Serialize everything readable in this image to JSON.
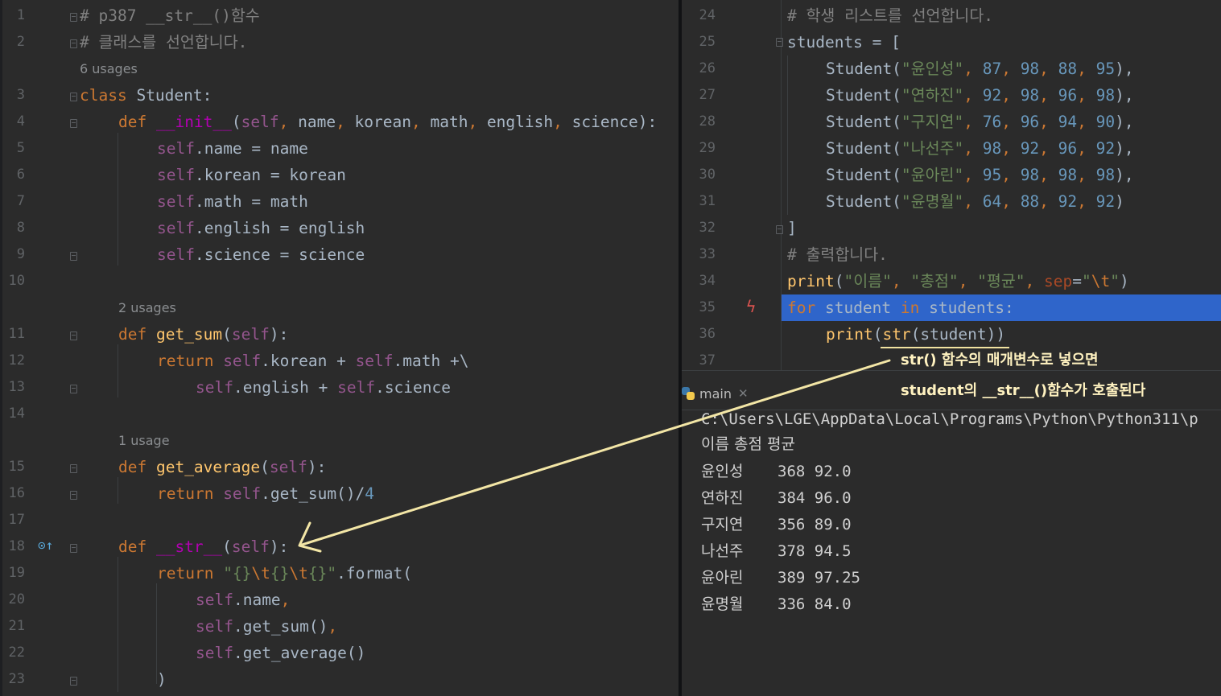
{
  "left_editor": {
    "lines": [
      {
        "n": "1",
        "t": [
          [
            "cmt",
            "# p387 __str__()함수"
          ]
        ]
      },
      {
        "n": "2",
        "t": [
          [
            "cmt",
            "# 클래스를 선언합니다."
          ]
        ]
      },
      {
        "n": "3",
        "t": [
          [
            "kw",
            "class "
          ],
          [
            "",
            "Student:"
          ]
        ]
      },
      {
        "n": "4",
        "t": [
          [
            "kw",
            "def "
          ],
          [
            "dunder",
            "__init__"
          ],
          [
            "",
            "("
          ],
          [
            "self",
            "self"
          ],
          [
            "kw",
            ", "
          ],
          [
            "",
            "name"
          ],
          [
            "kw",
            ", "
          ],
          [
            "",
            "korean"
          ],
          [
            "kw",
            ", "
          ],
          [
            "",
            "math"
          ],
          [
            "kw",
            ", "
          ],
          [
            "",
            "english"
          ],
          [
            "kw",
            ", "
          ],
          [
            "",
            "science):"
          ]
        ]
      },
      {
        "n": "5",
        "t": [
          [
            "self",
            "self"
          ],
          [
            "",
            ".name = name"
          ]
        ]
      },
      {
        "n": "6",
        "t": [
          [
            "self",
            "self"
          ],
          [
            "",
            ".korean = korean"
          ]
        ]
      },
      {
        "n": "7",
        "t": [
          [
            "self",
            "self"
          ],
          [
            "",
            ".math = math"
          ]
        ]
      },
      {
        "n": "8",
        "t": [
          [
            "self",
            "self"
          ],
          [
            "",
            ".english = english"
          ]
        ]
      },
      {
        "n": "9",
        "t": [
          [
            "self",
            "self"
          ],
          [
            "",
            ".science = science"
          ]
        ]
      },
      {
        "n": "10",
        "t": []
      },
      {
        "n": "11",
        "t": [
          [
            "kw",
            "def "
          ],
          [
            "fn",
            "get_sum"
          ],
          [
            "",
            "("
          ],
          [
            "self",
            "self"
          ],
          [
            "",
            "):"
          ]
        ]
      },
      {
        "n": "12",
        "t": [
          [
            "kw",
            "return "
          ],
          [
            "self",
            "self"
          ],
          [
            "",
            ".korean + "
          ],
          [
            "self",
            "self"
          ],
          [
            "",
            ".math +\\"
          ]
        ]
      },
      {
        "n": "13",
        "t": [
          [
            "self",
            "self"
          ],
          [
            "",
            ".english + "
          ],
          [
            "self",
            "self"
          ],
          [
            "",
            ".science"
          ]
        ]
      },
      {
        "n": "14",
        "t": []
      },
      {
        "n": "15",
        "t": [
          [
            "kw",
            "def "
          ],
          [
            "fn",
            "get_average"
          ],
          [
            "",
            "("
          ],
          [
            "self",
            "self"
          ],
          [
            "",
            "):"
          ]
        ]
      },
      {
        "n": "16",
        "t": [
          [
            "kw",
            "return "
          ],
          [
            "self",
            "self"
          ],
          [
            "",
            ".get_sum()/"
          ],
          [
            "num",
            "4"
          ]
        ]
      },
      {
        "n": "17",
        "t": []
      },
      {
        "n": "18",
        "t": [
          [
            "kw",
            "def "
          ],
          [
            "dunder",
            "__str__"
          ],
          [
            "",
            "("
          ],
          [
            "self",
            "self"
          ],
          [
            "",
            "):"
          ]
        ]
      },
      {
        "n": "19",
        "t": [
          [
            "kw",
            "return "
          ],
          [
            "str",
            "\"{}"
          ],
          [
            "esc",
            "\\t"
          ],
          [
            "str",
            "{}"
          ],
          [
            "esc",
            "\\t"
          ],
          [
            "str",
            "{}\""
          ],
          [
            "",
            ".format("
          ]
        ]
      },
      {
        "n": "20",
        "t": [
          [
            "self",
            "self"
          ],
          [
            "",
            ".name"
          ],
          [
            "kw",
            ","
          ]
        ]
      },
      {
        "n": "21",
        "t": [
          [
            "self",
            "self"
          ],
          [
            "",
            ".get_sum()"
          ],
          [
            "kw",
            ","
          ]
        ]
      },
      {
        "n": "22",
        "t": [
          [
            "self",
            "self"
          ],
          [
            "",
            ".get_average()"
          ]
        ]
      },
      {
        "n": "23",
        "t": [
          [
            "",
            ")"
          ]
        ]
      }
    ],
    "usage_hints": [
      "6 usages",
      "2 usages",
      "1 usage"
    ]
  },
  "right_editor": {
    "lines": [
      {
        "n": "24",
        "t": [
          [
            "cmt",
            "# 학생 리스트를 선언합니다."
          ]
        ]
      },
      {
        "n": "25",
        "t": [
          [
            "",
            "students = ["
          ]
        ]
      },
      {
        "n": "26",
        "t": [
          [
            "",
            "Student("
          ],
          [
            "str",
            "\"윤인성\""
          ],
          [
            "kw",
            ", "
          ],
          [
            "num",
            "87"
          ],
          [
            "kw",
            ", "
          ],
          [
            "num",
            "98"
          ],
          [
            "kw",
            ", "
          ],
          [
            "num",
            "88"
          ],
          [
            "kw",
            ", "
          ],
          [
            "num",
            "95"
          ],
          [
            "",
            "),"
          ]
        ]
      },
      {
        "n": "27",
        "t": [
          [
            "",
            "Student("
          ],
          [
            "str",
            "\"연하진\""
          ],
          [
            "kw",
            ", "
          ],
          [
            "num",
            "92"
          ],
          [
            "kw",
            ", "
          ],
          [
            "num",
            "98"
          ],
          [
            "kw",
            ", "
          ],
          [
            "num",
            "96"
          ],
          [
            "kw",
            ", "
          ],
          [
            "num",
            "98"
          ],
          [
            "",
            "),"
          ]
        ]
      },
      {
        "n": "28",
        "t": [
          [
            "",
            "Student("
          ],
          [
            "str",
            "\"구지연\""
          ],
          [
            "kw",
            ", "
          ],
          [
            "num",
            "76"
          ],
          [
            "kw",
            ", "
          ],
          [
            "num",
            "96"
          ],
          [
            "kw",
            ", "
          ],
          [
            "num",
            "94"
          ],
          [
            "kw",
            ", "
          ],
          [
            "num",
            "90"
          ],
          [
            "",
            "),"
          ]
        ]
      },
      {
        "n": "29",
        "t": [
          [
            "",
            "Student("
          ],
          [
            "str",
            "\"나선주\""
          ],
          [
            "kw",
            ", "
          ],
          [
            "num",
            "98"
          ],
          [
            "kw",
            ", "
          ],
          [
            "num",
            "92"
          ],
          [
            "kw",
            ", "
          ],
          [
            "num",
            "96"
          ],
          [
            "kw",
            ", "
          ],
          [
            "num",
            "92"
          ],
          [
            "",
            "),"
          ]
        ]
      },
      {
        "n": "30",
        "t": [
          [
            "",
            "Student("
          ],
          [
            "str",
            "\"윤아린\""
          ],
          [
            "kw",
            ", "
          ],
          [
            "num",
            "95"
          ],
          [
            "kw",
            ", "
          ],
          [
            "num",
            "98"
          ],
          [
            "kw",
            ", "
          ],
          [
            "num",
            "98"
          ],
          [
            "kw",
            ", "
          ],
          [
            "num",
            "98"
          ],
          [
            "",
            "),"
          ]
        ]
      },
      {
        "n": "31",
        "t": [
          [
            "",
            "Student("
          ],
          [
            "str",
            "\"윤명월\""
          ],
          [
            "kw",
            ", "
          ],
          [
            "num",
            "64"
          ],
          [
            "kw",
            ", "
          ],
          [
            "num",
            "88"
          ],
          [
            "kw",
            ", "
          ],
          [
            "num",
            "92"
          ],
          [
            "kw",
            ", "
          ],
          [
            "num",
            "92"
          ],
          [
            "",
            ")"
          ]
        ]
      },
      {
        "n": "32",
        "t": [
          [
            "",
            "]"
          ]
        ]
      },
      {
        "n": "33",
        "t": [
          [
            "cmt",
            "# 출력합니다."
          ]
        ]
      },
      {
        "n": "34",
        "t": [
          [
            "fn2",
            "print"
          ],
          [
            "",
            "("
          ],
          [
            "str",
            "\"이름\""
          ],
          [
            "kw",
            ", "
          ],
          [
            "str",
            "\"총점\""
          ],
          [
            "kw",
            ", "
          ],
          [
            "str",
            "\"평균\""
          ],
          [
            "kw",
            ", "
          ],
          [
            "kwarg",
            "sep"
          ],
          [
            "",
            "="
          ],
          [
            "str",
            "\""
          ],
          [
            "esc",
            "\\t"
          ],
          [
            "str",
            "\""
          ],
          [
            "",
            ")"
          ]
        ]
      },
      {
        "n": "35",
        "t": [
          [
            "kw",
            "for "
          ],
          [
            "",
            "student "
          ],
          [
            "kw",
            "in "
          ],
          [
            "",
            "students:"
          ]
        ]
      },
      {
        "n": "36",
        "t": [
          [
            "fn2",
            "print"
          ],
          [
            "",
            "("
          ],
          [
            "fn2",
            "str"
          ],
          [
            "",
            "(student))"
          ]
        ]
      },
      {
        "n": "37",
        "t": []
      }
    ]
  },
  "annotation": {
    "line1": "str() 함수의 매개변수로 넣으면",
    "line2": "student의 __str__()함수가 호출된다"
  },
  "run_panel": {
    "tab_label": "main",
    "path": "C:\\Users\\LGE\\AppData\\Local\\Programs\\Python\\Python311\\p",
    "header": "이름 총점 평균",
    "rows": [
      {
        "name": "윤인성",
        "sum": "368",
        "avg": "92.0"
      },
      {
        "name": "연하진",
        "sum": "384",
        "avg": "96.0"
      },
      {
        "name": "구지연",
        "sum": "356",
        "avg": "89.0"
      },
      {
        "name": "나선주",
        "sum": "378",
        "avg": "94.5"
      },
      {
        "name": "윤아린",
        "sum": "389",
        "avg": "97.25"
      },
      {
        "name": "윤명월",
        "sum": "336",
        "avg": "84.0"
      }
    ]
  }
}
